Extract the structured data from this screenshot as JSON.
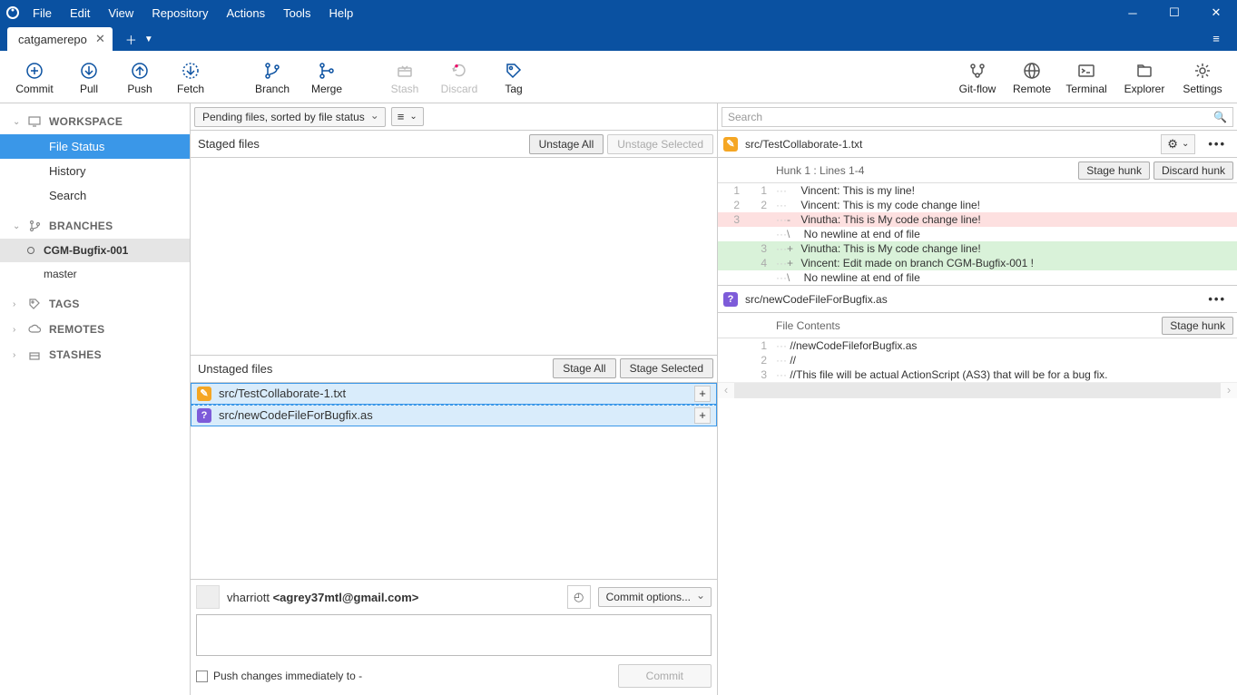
{
  "menu": [
    "File",
    "Edit",
    "View",
    "Repository",
    "Actions",
    "Tools",
    "Help"
  ],
  "tab": {
    "name": "catgamerepo"
  },
  "toolbar": {
    "commit": "Commit",
    "pull": "Pull",
    "push": "Push",
    "fetch": "Fetch",
    "branch": "Branch",
    "merge": "Merge",
    "stash": "Stash",
    "discard": "Discard",
    "tag": "Tag",
    "gitflow": "Git-flow",
    "remote": "Remote",
    "terminal": "Terminal",
    "explorer": "Explorer",
    "settings": "Settings"
  },
  "sidebar": {
    "workspace": {
      "label": "WORKSPACE",
      "items": [
        "File Status",
        "History",
        "Search"
      ]
    },
    "branches": {
      "label": "BRANCHES",
      "items": [
        "CGM-Bugfix-001",
        "master"
      ]
    },
    "tags": {
      "label": "TAGS"
    },
    "remotes": {
      "label": "REMOTES"
    },
    "stashes": {
      "label": "STASHES"
    }
  },
  "filter": {
    "sort": "Pending files, sorted by file status"
  },
  "staged": {
    "title": "Staged files",
    "unstage_all": "Unstage All",
    "unstage_sel": "Unstage Selected"
  },
  "unstaged": {
    "title": "Unstaged files",
    "stage_all": "Stage All",
    "stage_sel": "Stage Selected",
    "files": [
      {
        "path": "src/TestCollaborate-1.txt",
        "kind": "mod"
      },
      {
        "path": "src/newCodeFileForBugfix.as",
        "kind": "unk"
      }
    ]
  },
  "commit": {
    "author_name": "vharriott",
    "author_email": "<agrey37mtl@gmail.com>",
    "options": "Commit options...",
    "push_label": "Push changes immediately to -",
    "button": "Commit"
  },
  "search": {
    "placeholder": "Search"
  },
  "diff1": {
    "path": "src/TestCollaborate-1.txt",
    "hunk_label": "Hunk 1 : Lines 1-4",
    "stage": "Stage hunk",
    "discard": "Discard hunk",
    "lines": [
      {
        "a": "1",
        "b": "1",
        "cls": "",
        "m": " ",
        "t": "Vincent: This is my line!"
      },
      {
        "a": "2",
        "b": "2",
        "cls": "",
        "m": " ",
        "t": "Vincent: This is my code change line!"
      },
      {
        "a": "3",
        "b": "",
        "cls": "del",
        "m": "-",
        "t": "Vinutha: This is My code change line!"
      },
      {
        "a": "",
        "b": "",
        "cls": "",
        "m": "\\",
        "t": " No newline at end of file"
      },
      {
        "a": "",
        "b": "3",
        "cls": "add",
        "m": "+",
        "t": "Vinutha: This is My code change line!"
      },
      {
        "a": "",
        "b": "4",
        "cls": "add",
        "m": "+",
        "t": "Vincent: Edit made on branch CGM-Bugfix-001 !"
      },
      {
        "a": "",
        "b": "",
        "cls": "",
        "m": "\\",
        "t": " No newline at end of file"
      }
    ]
  },
  "diff2": {
    "path": "src/newCodeFileForBugfix.as",
    "hunk_label": "File Contents",
    "stage": "Stage hunk",
    "lines": [
      {
        "b": "1",
        "t": "//newCodeFileforBugfix.as"
      },
      {
        "b": "2",
        "t": "//"
      },
      {
        "b": "3",
        "t": "//This file will be actual ActionScript (AS3) that will be for a bug fix."
      }
    ]
  }
}
